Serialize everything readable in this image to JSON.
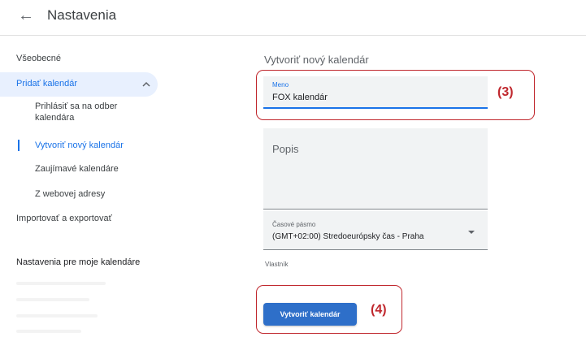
{
  "header": {
    "back_icon": "arrow-left-icon",
    "title": "Nastavenia"
  },
  "sidebar": {
    "general": "Všeobecné",
    "add_calendar": "Pridať kalendár",
    "subitems": [
      "Prihlásiť sa na odber kalendára",
      "Vytvoriť nový kalendár",
      "Zaujímavé kalendáre",
      "Z webovej adresy"
    ],
    "import_export": "Importovať a exportovať",
    "my_calendars_heading": "Nastavenia pre moje kalendáre",
    "accent_color": "#1a73e8",
    "active_bg_color": "#e8f0fe"
  },
  "main": {
    "section_title": "Vytvoriť nový kalendár",
    "name_field": {
      "label": "Meno",
      "value": "FOX kalendár"
    },
    "description_field": {
      "placeholder": "Popis"
    },
    "timezone_field": {
      "label": "Časové pásmo",
      "value": "(GMT+02:00) Stredoeurópsky čas - Praha"
    },
    "owner_label": "Vlastník",
    "create_button": "Vytvoriť kalendár",
    "button_color": "#2e6fc9"
  },
  "annotations": {
    "name_callout": "(3)",
    "button_callout": "(4)",
    "color": "#c0282e"
  }
}
